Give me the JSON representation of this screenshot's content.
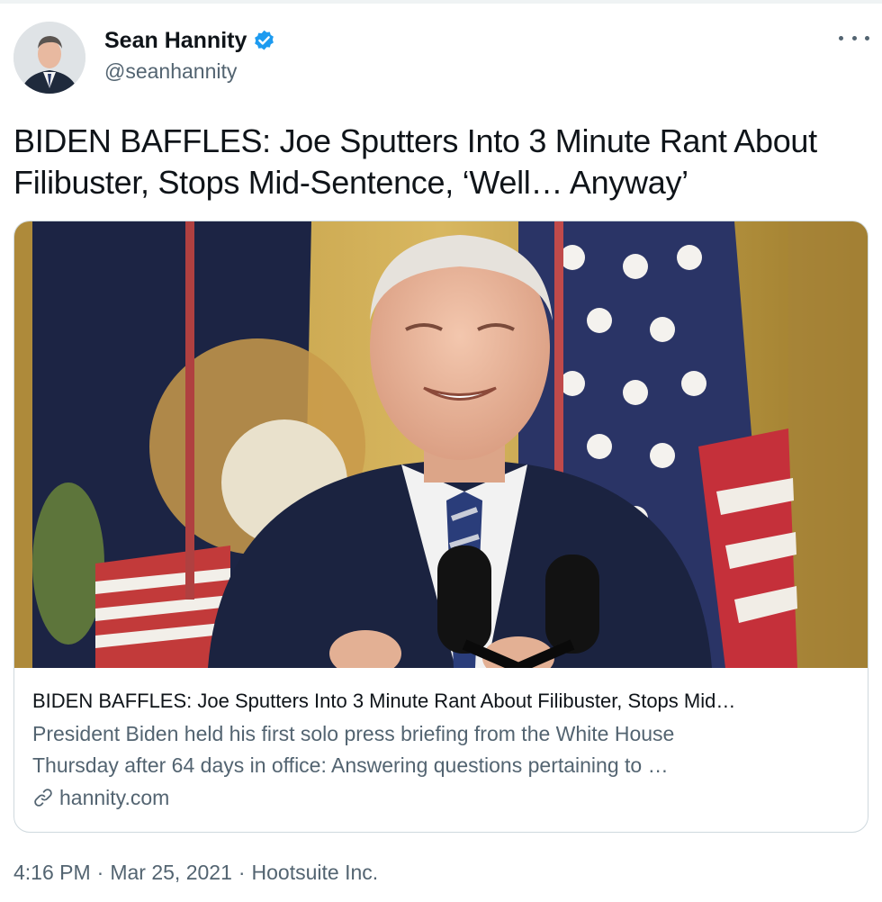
{
  "colors": {
    "text": "#0f1419",
    "secondary": "#536471",
    "verified": "#1d9bf0",
    "border": "#cfd9de"
  },
  "author": {
    "display_name": "Sean Hannity",
    "handle": "@seanhannity",
    "verified_icon": "verified-badge-icon",
    "more_icon": "more-options-icon"
  },
  "tweet": {
    "text_line1": "BIDEN BAFFLES: Joe Sputters Into 3 Minute Rant About",
    "text_line2": "Filibuster, Stops Mid-Sentence, ‘Well… Anyway’"
  },
  "card": {
    "title": "BIDEN BAFFLES: Joe Sputters Into 3 Minute Rant About Filibuster, Stops Mid…",
    "description_line1": "President Biden held his first solo press briefing from the White House",
    "description_line2": "Thursday after 64 days in office: Answering questions pertaining to …",
    "domain": "hannity.com",
    "domain_icon": "link-icon"
  },
  "footer": {
    "time": "4:16 PM",
    "separator": "·",
    "date": "Mar 25, 2021",
    "source": "Hootsuite Inc."
  }
}
